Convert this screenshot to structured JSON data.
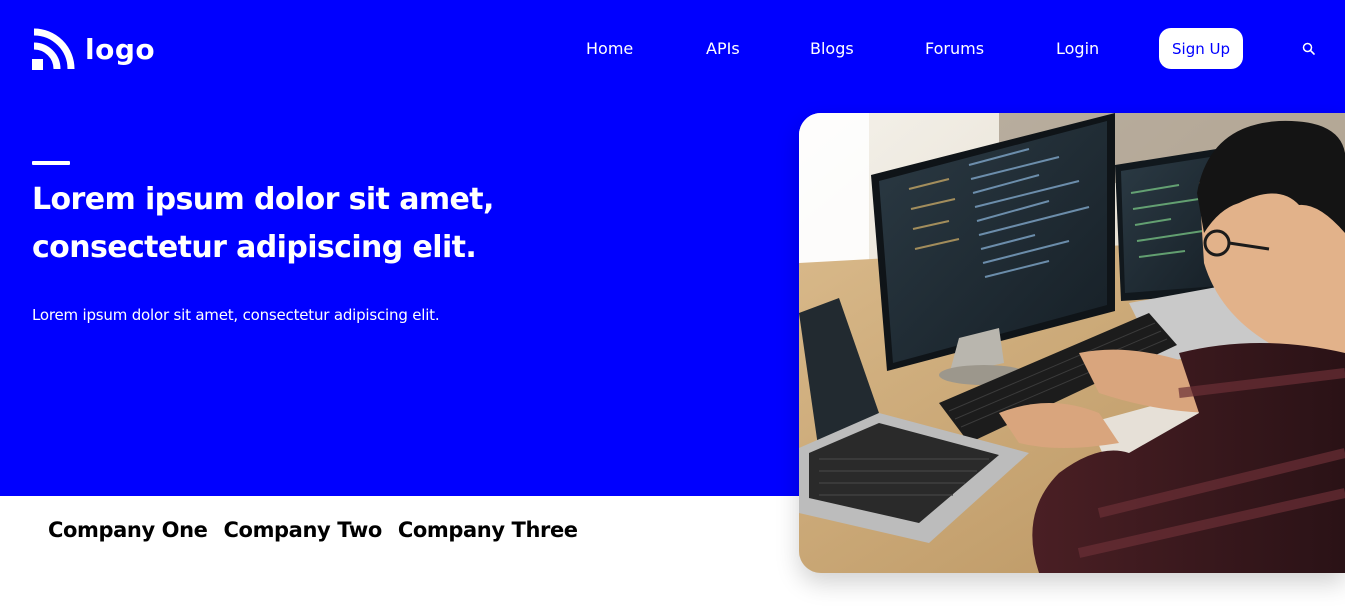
{
  "brand": {
    "logo_text": "logo",
    "logo_icon": "rss-feed-icon"
  },
  "nav": {
    "items": [
      {
        "label": "Home"
      },
      {
        "label": "APIs"
      },
      {
        "label": "Blogs"
      },
      {
        "label": "Forums"
      },
      {
        "label": "Login"
      }
    ],
    "signup_label": "Sign Up",
    "search_icon": "search-icon"
  },
  "hero": {
    "headline_line1": "Lorem ipsum dolor sit amet,",
    "headline_line2": "consectetur adipiscing elit.",
    "subtext": "Lorem ipsum dolor sit amet, consectetur adipiscing elit.",
    "image_alt": "Developer working at multiple computer screens"
  },
  "companies": [
    {
      "name": "Company One"
    },
    {
      "name": "Company Two"
    },
    {
      "name": "Company Three"
    }
  ],
  "colors": {
    "primary": "#0000ff",
    "on_primary": "#ffffff",
    "text_dark": "#000000",
    "background": "#ffffff"
  }
}
